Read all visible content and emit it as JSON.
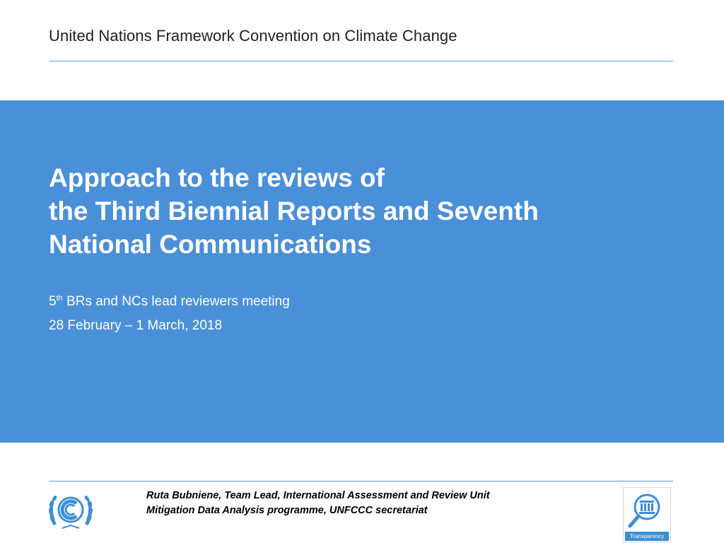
{
  "header": {
    "org_title": "United Nations Framework Convention on Climate Change"
  },
  "banner": {
    "title_lines": [
      "Approach to the reviews of",
      "the Third Biennial Reports and Seventh",
      "National Communications"
    ],
    "meeting_prefix": "5",
    "meeting_sup": "th",
    "meeting_rest": " BRs and NCs lead reviewers meeting",
    "dates": "28 February – 1 March, 2018"
  },
  "footer": {
    "presenter_line1": "Ruta Bubniene,  Team Lead, International Assessment and Review Unit",
    "presenter_line2": "Mitigation Data Analysis programme, UNFCCC secretariat",
    "transparency_label": "Transparency"
  },
  "colors": {
    "banner": "#4a90d9",
    "rule": "#5b9bd5",
    "logo_blue": "#3b8fd6"
  },
  "icons": {
    "left_logo": "unfccc-logo-icon",
    "right_logo": "transparency-logo-icon"
  }
}
